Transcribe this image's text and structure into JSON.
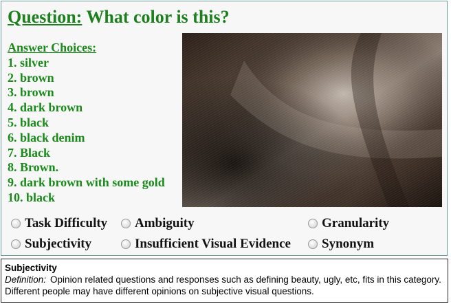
{
  "question": {
    "label": "Question:",
    "text": "What color is this?"
  },
  "answers": {
    "heading": "Answer Choices:",
    "items": [
      "1. silver",
      "2. brown",
      "3. brown",
      "4. dark brown",
      "5. black",
      "6. black denim",
      "7. Black",
      "8. Brown.",
      "9. dark brown with some gold",
      "10. black"
    ]
  },
  "options": [
    "Task Difficulty",
    "Ambiguity",
    "Granularity",
    "Subjectivity",
    "Insufficient Visual Evidence",
    "Synonym"
  ],
  "definition": {
    "title": "Subjectivity",
    "label": "Definition:",
    "text": "Opinion related questions and responses such as defining beauty, ugly, etc, fits in this category. Different people may have different opinions on subjective visual questions."
  },
  "colors": {
    "question": "#1e7f1e",
    "answers": "#1a8a1a",
    "panel_border": "#6a9a9a"
  }
}
